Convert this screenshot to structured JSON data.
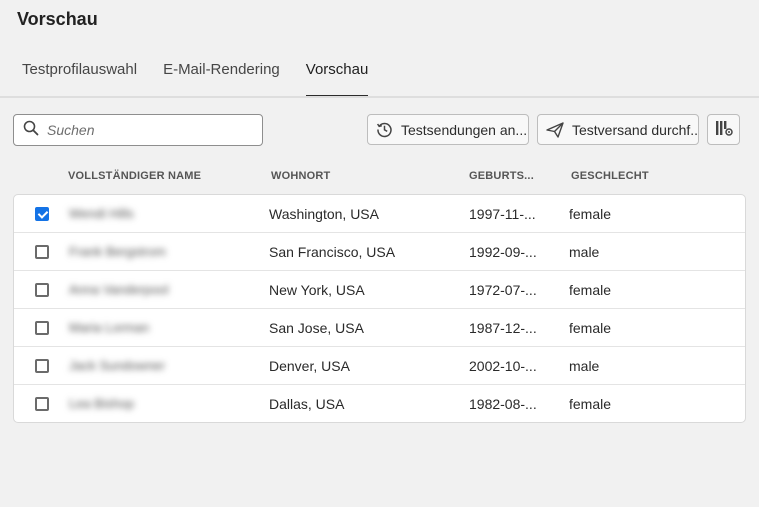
{
  "page": {
    "title": "Vorschau"
  },
  "tabs": [
    {
      "label": "Testprofilauswahl",
      "active": false
    },
    {
      "label": "E-Mail-Rendering",
      "active": false
    },
    {
      "label": "Vorschau",
      "active": true
    }
  ],
  "search": {
    "placeholder": "Suchen",
    "icon": "search-icon"
  },
  "toolbar": {
    "history_label": "Testsendungen an...",
    "history_icon": "history-icon",
    "send_label": "Testversand durchf...",
    "send_icon": "paper-plane-icon",
    "settings_icon": "column-settings-icon"
  },
  "table": {
    "columns": [
      "VOLLSTÄNDIGER NAME",
      "WOHNORT",
      "GEBURTS...",
      "GESCHLECHT"
    ],
    "rows": [
      {
        "checked": true,
        "name": "Wendi Hills",
        "city": "Washington, USA",
        "birth": "1997-11-...",
        "gender": "female"
      },
      {
        "checked": false,
        "name": "Frank Bergstrom",
        "city": "San Francisco, USA",
        "birth": "1992-09-...",
        "gender": "male"
      },
      {
        "checked": false,
        "name": "Anna Vanderpool",
        "city": "New York, USA",
        "birth": "1972-07-...",
        "gender": "female"
      },
      {
        "checked": false,
        "name": "Maria Lorman",
        "city": "San Jose, USA",
        "birth": "1987-12-...",
        "gender": "female"
      },
      {
        "checked": false,
        "name": "Jack Sundowner",
        "city": "Denver, USA",
        "birth": "2002-10-...",
        "gender": "male"
      },
      {
        "checked": false,
        "name": "Lea Bishop",
        "city": "Dallas, USA",
        "birth": "1982-08-...",
        "gender": "female"
      }
    ]
  },
  "colors": {
    "accent": "#1473e6",
    "background": "#f1f1f1"
  }
}
